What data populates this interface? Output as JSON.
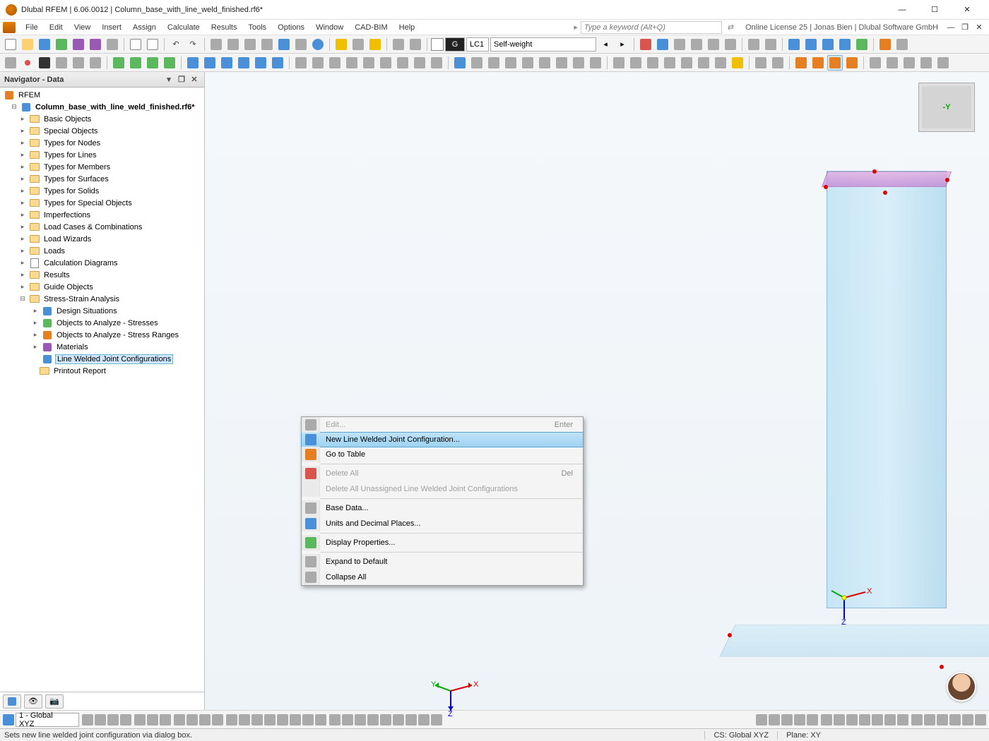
{
  "titlebar": {
    "app": "Dlubal RFEM",
    "version": "6.06.0012",
    "document": "Column_base_with_line_weld_finished.rf6*"
  },
  "menubar": {
    "items": [
      "File",
      "Edit",
      "View",
      "Insert",
      "Assign",
      "Calculate",
      "Results",
      "Tools",
      "Options",
      "Window",
      "CAD-BIM",
      "Help"
    ],
    "search_placeholder": "Type a keyword (Alt+Q)",
    "license": "Online License 25 | Jonas Bien | Dlubal Software GmbH"
  },
  "toolbar1": {
    "lc_badge": "G",
    "lc_code": "LC1",
    "loadcase": "Self-weight"
  },
  "navigator": {
    "title": "Navigator - Data",
    "root": "RFEM",
    "project": "Column_base_with_line_weld_finished.rf6*",
    "items": [
      {
        "label": "Basic Objects",
        "icon": "folder"
      },
      {
        "label": "Special Objects",
        "icon": "folder"
      },
      {
        "label": "Types for Nodes",
        "icon": "folder"
      },
      {
        "label": "Types for Lines",
        "icon": "folder"
      },
      {
        "label": "Types for Members",
        "icon": "folder"
      },
      {
        "label": "Types for Surfaces",
        "icon": "folder"
      },
      {
        "label": "Types for Solids",
        "icon": "folder"
      },
      {
        "label": "Types for Special Objects",
        "icon": "folder"
      },
      {
        "label": "Imperfections",
        "icon": "folder"
      },
      {
        "label": "Load Cases & Combinations",
        "icon": "folder"
      },
      {
        "label": "Load Wizards",
        "icon": "folder"
      },
      {
        "label": "Loads",
        "icon": "folder"
      },
      {
        "label": "Calculation Diagrams",
        "icon": "chart"
      },
      {
        "label": "Results",
        "icon": "folder"
      },
      {
        "label": "Guide Objects",
        "icon": "folder"
      }
    ],
    "stress_group": {
      "label": "Stress-Strain Analysis",
      "children": [
        {
          "label": "Design Situations"
        },
        {
          "label": "Objects to Analyze - Stresses"
        },
        {
          "label": "Objects to Analyze - Stress Ranges"
        },
        {
          "label": "Materials"
        },
        {
          "label": "Line Welded Joint Configurations",
          "selected": true
        }
      ]
    },
    "printout": "Printout Report"
  },
  "context_menu": {
    "items": [
      {
        "label": "Edit...",
        "shortcut": "Enter",
        "disabled": true,
        "icon": "edit"
      },
      {
        "label": "New Line Welded Joint Configuration...",
        "highlight": true,
        "icon": "new"
      },
      {
        "label": "Go to Table",
        "icon": "table"
      },
      {
        "sep": true
      },
      {
        "label": "Delete All",
        "shortcut": "Del",
        "disabled": true,
        "icon": "delete"
      },
      {
        "label": "Delete All Unassigned Line Welded Joint Configurations",
        "disabled": true
      },
      {
        "sep": true
      },
      {
        "label": "Base Data...",
        "icon": "base"
      },
      {
        "label": "Units and Decimal Places...",
        "icon": "units"
      },
      {
        "sep": true
      },
      {
        "label": "Display Properties...",
        "icon": "display"
      },
      {
        "sep": true
      },
      {
        "label": "Expand to Default",
        "icon": "expand"
      },
      {
        "label": "Collapse All",
        "icon": "collapse"
      }
    ]
  },
  "viewport": {
    "axes": {
      "x": "X",
      "y": "Y",
      "z": "Z"
    },
    "cube_face": "-Y"
  },
  "bottombar": {
    "workplane": "1 - Global XYZ"
  },
  "statusbar": {
    "hint": "Sets new line welded joint configuration via dialog box.",
    "cs": "CS: Global XYZ",
    "plane": "Plane: XY"
  }
}
